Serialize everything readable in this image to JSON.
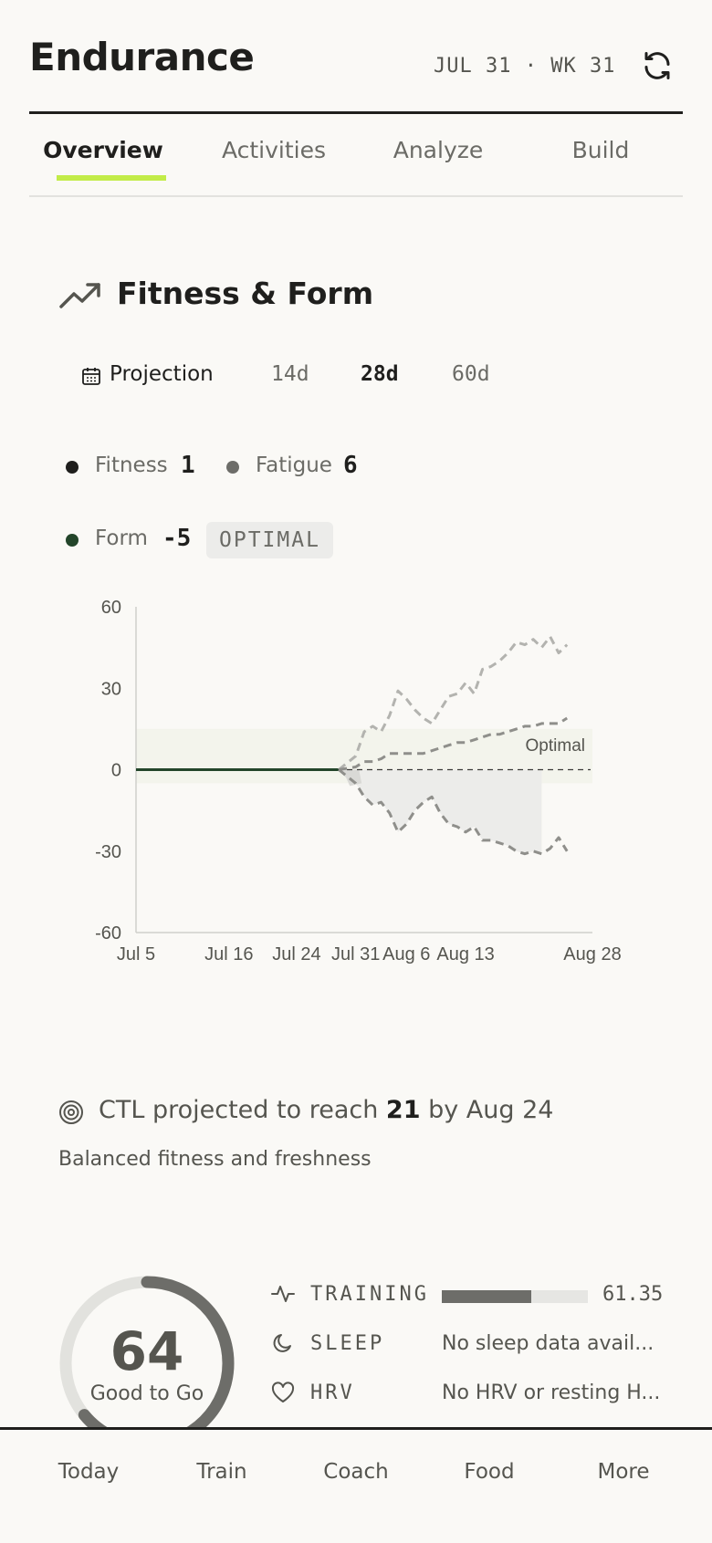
{
  "header": {
    "title": "Endurance",
    "date": "JUL 31 · WK 31"
  },
  "tabs": [
    {
      "label": "Overview",
      "active": true
    },
    {
      "label": "Activities",
      "active": false
    },
    {
      "label": "Analyze",
      "active": false
    },
    {
      "label": "Build",
      "active": false
    }
  ],
  "section": {
    "title": "Fitness & Form",
    "icon": "trend-up-icon"
  },
  "range": {
    "label": "Projection",
    "options": [
      "14d",
      "28d",
      "60d"
    ],
    "selected": "28d"
  },
  "metrics": {
    "fitness": {
      "label": "Fitness",
      "value": "1",
      "color": "#1f1f1d"
    },
    "fatigue": {
      "label": "Fatigue",
      "value": "6",
      "color": "#6d6d69"
    },
    "form": {
      "label": "Form",
      "value": "-5",
      "badge": "OPTIMAL",
      "color": "#23452a"
    }
  },
  "chart_data": {
    "type": "line",
    "y_ticks": [
      "60",
      "30",
      "0",
      "-30",
      "-60"
    ],
    "ylim": [
      -60,
      60
    ],
    "x_tick_labels": [
      "Jul 5",
      "Jul 16",
      "Jul 24",
      "Jul 31",
      "Aug 6",
      "Aug 13",
      "Aug 28"
    ],
    "x_tick_dates": [
      "2024-07-05",
      "2024-07-16",
      "2024-07-24",
      "2024-07-31",
      "2024-08-06",
      "2024-08-13",
      "2024-08-28"
    ],
    "band": {
      "label": "Optimal",
      "range": [
        -5,
        15
      ]
    },
    "series": [
      {
        "x": [
          "2024-07-05",
          "2024-07-29"
        ],
        "values": [
          0,
          0
        ],
        "style": "solid",
        "color": "#23452a"
      },
      {
        "x": [
          "2024-07-29",
          "2024-07-31",
          "2024-08-01",
          "2024-08-02",
          "2024-08-03",
          "2024-08-04",
          "2024-08-05",
          "2024-08-06",
          "2024-08-07",
          "2024-08-08",
          "2024-08-09",
          "2024-08-10",
          "2024-08-11",
          "2024-08-12",
          "2024-08-13",
          "2024-08-14",
          "2024-08-15",
          "2024-08-16",
          "2024-08-17",
          "2024-08-18",
          "2024-08-19",
          "2024-08-20",
          "2024-08-21",
          "2024-08-22",
          "2024-08-23",
          "2024-08-24",
          "2024-08-25"
        ],
        "values": [
          0,
          5,
          14,
          16,
          14,
          20,
          29,
          26,
          22,
          19,
          17,
          22,
          27,
          28,
          32,
          28,
          37,
          38,
          40,
          43,
          47,
          46,
          48,
          45,
          49,
          43,
          46
        ],
        "style": "dashed",
        "color": "#b3b3af"
      },
      {
        "x": [
          "2024-07-29",
          "2024-07-31",
          "2024-08-01",
          "2024-08-02",
          "2024-08-03",
          "2024-08-04",
          "2024-08-05",
          "2024-08-06",
          "2024-08-07",
          "2024-08-08",
          "2024-08-09",
          "2024-08-10",
          "2024-08-11",
          "2024-08-12",
          "2024-08-13",
          "2024-08-14",
          "2024-08-15",
          "2024-08-16",
          "2024-08-17",
          "2024-08-18",
          "2024-08-19",
          "2024-08-20",
          "2024-08-21",
          "2024-08-22",
          "2024-08-23",
          "2024-08-24",
          "2024-08-25"
        ],
        "values": [
          0,
          1,
          3,
          3,
          4,
          6,
          6,
          6,
          6,
          6,
          7,
          8,
          9,
          10,
          10,
          11,
          12,
          13,
          13,
          14,
          15,
          16,
          16,
          17,
          17,
          17,
          19
        ],
        "style": "dashed",
        "color": "#8f8f8b"
      },
      {
        "x": [
          "2024-07-29",
          "2024-07-31",
          "2024-08-01",
          "2024-08-02",
          "2024-08-03",
          "2024-08-04",
          "2024-08-05",
          "2024-08-06",
          "2024-08-07",
          "2024-08-08",
          "2024-08-09",
          "2024-08-10",
          "2024-08-11",
          "2024-08-12",
          "2024-08-13",
          "2024-08-14",
          "2024-08-15",
          "2024-08-16",
          "2024-08-17",
          "2024-08-18",
          "2024-08-19",
          "2024-08-20",
          "2024-08-21",
          "2024-08-22",
          "2024-08-23",
          "2024-08-24",
          "2024-08-25"
        ],
        "values": [
          0,
          -5,
          -10,
          -13,
          -12,
          -16,
          -23,
          -20,
          -15,
          -12,
          -10,
          -16,
          -20,
          -21,
          -23,
          -21,
          -26,
          -26,
          -27,
          -28,
          -30,
          -31,
          -30,
          -31,
          -29,
          -25,
          -30
        ],
        "style": "dashed",
        "color": "#8f8f8b"
      }
    ],
    "shaded_area": {
      "x_start": "2024-07-29",
      "x_end": "2024-08-22"
    }
  },
  "projection": {
    "prefix": "CTL projected to reach",
    "value": "21",
    "suffix": "by Aug 24",
    "note": "Balanced fitness and freshness"
  },
  "readiness": {
    "score": "64",
    "score_fraction": 0.64,
    "status": "Good to Go",
    "rows": [
      {
        "label": "TRAINING",
        "value": "61.35",
        "fill": 0.61
      },
      {
        "label": "SLEEP",
        "value": "No sleep data avail..."
      },
      {
        "label": "HRV",
        "value": "No HRV or resting H..."
      }
    ]
  },
  "nav": [
    "Today",
    "Train",
    "Coach",
    "Food",
    "More"
  ]
}
